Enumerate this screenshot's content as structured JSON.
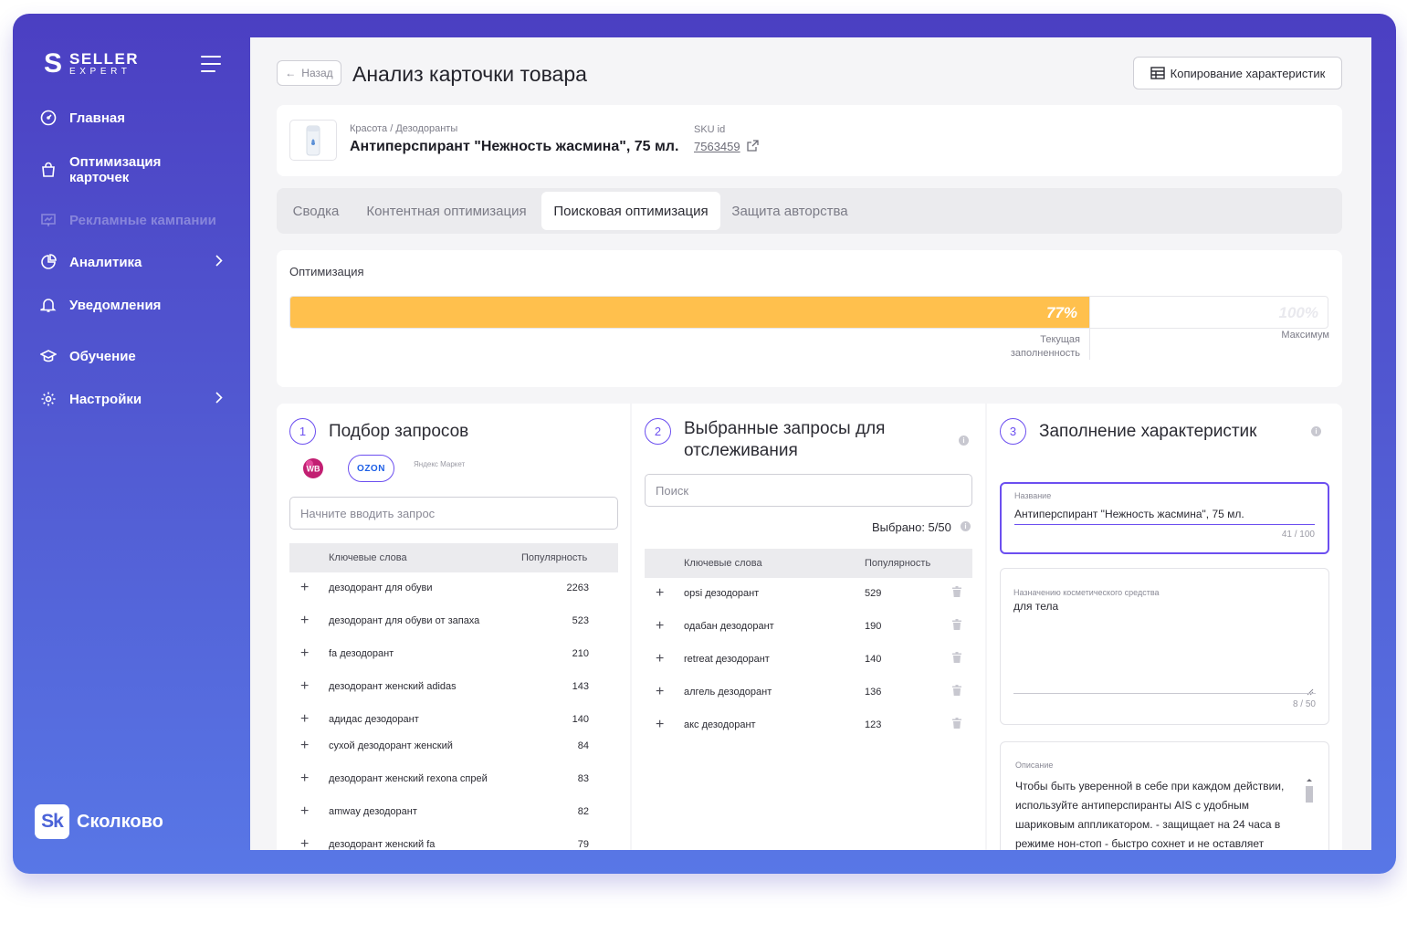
{
  "sidebar": {
    "logo_main": "SELLER",
    "logo_sub": "EXPERT",
    "items": [
      {
        "label": "Главная",
        "icon": "dashboard-icon"
      },
      {
        "label": "Оптимизация карточек",
        "icon": "shopping-bag-icon"
      },
      {
        "label": "Рекламные кампании",
        "icon": "presentation-icon"
      },
      {
        "label": "Аналитика",
        "icon": "pie-chart-icon"
      },
      {
        "label": "Уведомления",
        "icon": "bell-icon"
      },
      {
        "label": "Обучение",
        "icon": "graduation-cap-icon"
      },
      {
        "label": "Настройки",
        "icon": "gear-icon"
      }
    ],
    "partner": {
      "badge": "Sk",
      "name": "Сколково"
    }
  },
  "header": {
    "back_label": "Назад",
    "title": "Анализ карточки товара",
    "copy_label": "Копирование характеристик"
  },
  "product": {
    "category": "Красота / Дезодоранты",
    "name": "Антиперспирант \"Нежность жасмина\", 75 мл.",
    "sku_label": "SKU id",
    "sku": "7563459"
  },
  "tabs": [
    {
      "label": "Сводка"
    },
    {
      "label": "Контентная оптимизация"
    },
    {
      "label": "Поисковая оптимизация"
    },
    {
      "label": "Защита авторства"
    }
  ],
  "active_tab": "Поисковая оптимизация",
  "optimization": {
    "label": "Оптимизация",
    "current_percent": 77,
    "current_text": "77%",
    "max_text": "100%",
    "current_label_1": "Текущая",
    "current_label_2": "заполненность",
    "max_label": "Максимум"
  },
  "queries": {
    "step": "1",
    "title": "Подбор запросов",
    "marketplaces": [
      "WB",
      "OZON",
      "Яндекс Маркет"
    ],
    "input_placeholder": "Начните вводить запрос",
    "col_keywords": "Ключевые слова",
    "col_popularity": "Популярность",
    "rows": [
      {
        "kw": "дезодорант для обуви",
        "pop": "2263"
      },
      {
        "kw": "дезодорант для обуви от запаха",
        "pop": "523"
      },
      {
        "kw": "fa дезодорант",
        "pop": "210"
      },
      {
        "kw": "дезодорант женский adidas",
        "pop": "143"
      },
      {
        "kw": "адидас дезодорант",
        "pop": "140"
      },
      {
        "kw": "сухой дезодорант женский",
        "pop": "84"
      },
      {
        "kw": "дезодорант женский rexona спрей",
        "pop": "83"
      },
      {
        "kw": "amway дезодорант",
        "pop": "82"
      },
      {
        "kw": "дезодорант женский fa",
        "pop": "79"
      }
    ]
  },
  "selected": {
    "step": "2",
    "title_1": "Выбранные запросы для",
    "title_2": "отслеживания",
    "search_placeholder": "Поиск",
    "count_text": "Выбрано: 5/50",
    "col_keywords": "Ключевые слова",
    "col_popularity": "Популярность",
    "rows": [
      {
        "kw": "opsi дезодорант",
        "pop": "529"
      },
      {
        "kw": "одабан дезодорант",
        "pop": "190"
      },
      {
        "kw": "retreat дезодорант",
        "pop": "140"
      },
      {
        "kw": "алгель дезодорант",
        "pop": "136"
      },
      {
        "kw": "акс дезодорант",
        "pop": "123"
      }
    ]
  },
  "characteristics": {
    "step": "3",
    "title": "Заполнение характеристик",
    "name_label": "Название",
    "name_value": "Антиперспирант \"Нежность жасмина\", 75 мл.",
    "name_count": "41 / 100",
    "purpose_label": "Назначению косметического средства",
    "purpose_value": "для тела",
    "purpose_count": "8 / 50",
    "desc_label": "Описание",
    "desc_value": "Чтобы быть уверенной в себе при каждом действии, используйте антиперспиранты AIS с удобным шариковым аппликатором. - защищает на 24 часа в режиме нон-стоп - быстро сохнет и не оставляет"
  },
  "colors": {
    "accent": "#6c4ff0",
    "progress": "#ffc04d",
    "sidebar_top": "#4b3fc2",
    "sidebar_bottom": "#5877e6"
  }
}
